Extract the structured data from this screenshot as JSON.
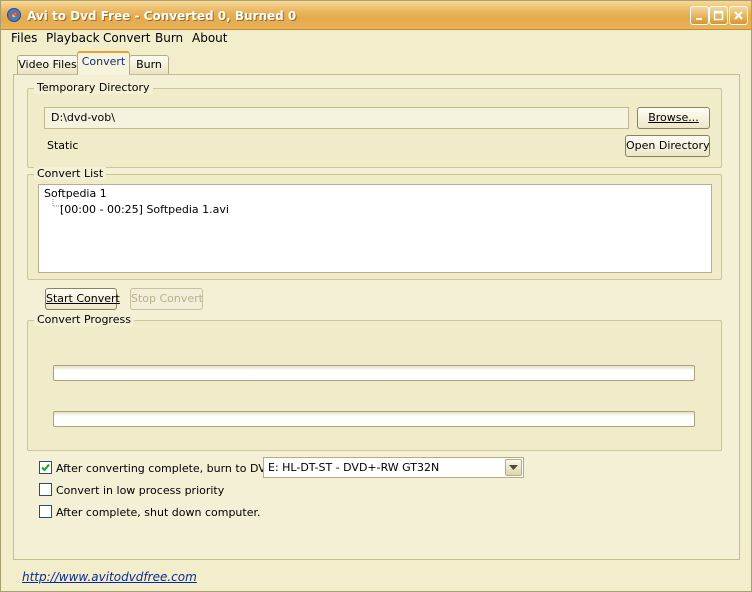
{
  "window": {
    "title": "Avi to Dvd Free - Converted 0, Burned 0"
  },
  "menu": [
    "Files",
    "Playback",
    "Convert",
    "Burn",
    "About"
  ],
  "tabs": [
    "Video Files",
    "Convert",
    "Burn"
  ],
  "active_tab": "Convert",
  "temp_dir": {
    "label": "Temporary Directory",
    "path": "D:\\dvd-vob\\",
    "browse_label": "Browse...",
    "status": "Static",
    "open_label": "Open Directory"
  },
  "convert_list": {
    "label": "Convert List",
    "root": "Softpedia 1",
    "child": "[00:00 - 00:25] Softpedia 1.avi"
  },
  "actions": {
    "start_label": "Start Convert",
    "stop_label": "Stop Convert"
  },
  "progress": {
    "label": "Convert Progress",
    "bar1": 0,
    "bar2": 0
  },
  "options": {
    "burn_after": "After converting complete, burn to DVD",
    "burn_after_checked": true,
    "low_priority": "Convert in low process priority",
    "low_priority_checked": false,
    "shutdown": "After complete, shut down computer.",
    "shutdown_checked": false,
    "drive": "E: HL-DT-ST - DVD+-RW GT32N"
  },
  "footer": {
    "link": "http://www.avitodvdfree.com"
  },
  "icons": {
    "app": "app-icon",
    "minimize": "minimize-icon",
    "maximize": "maximize-icon",
    "close": "close-icon",
    "check": "check-icon",
    "dropdown": "chevron-down-icon"
  },
  "colors": {
    "titlebar": "#e5a94a",
    "panel": "#f4f0d6",
    "link": "#0a2a9a"
  }
}
